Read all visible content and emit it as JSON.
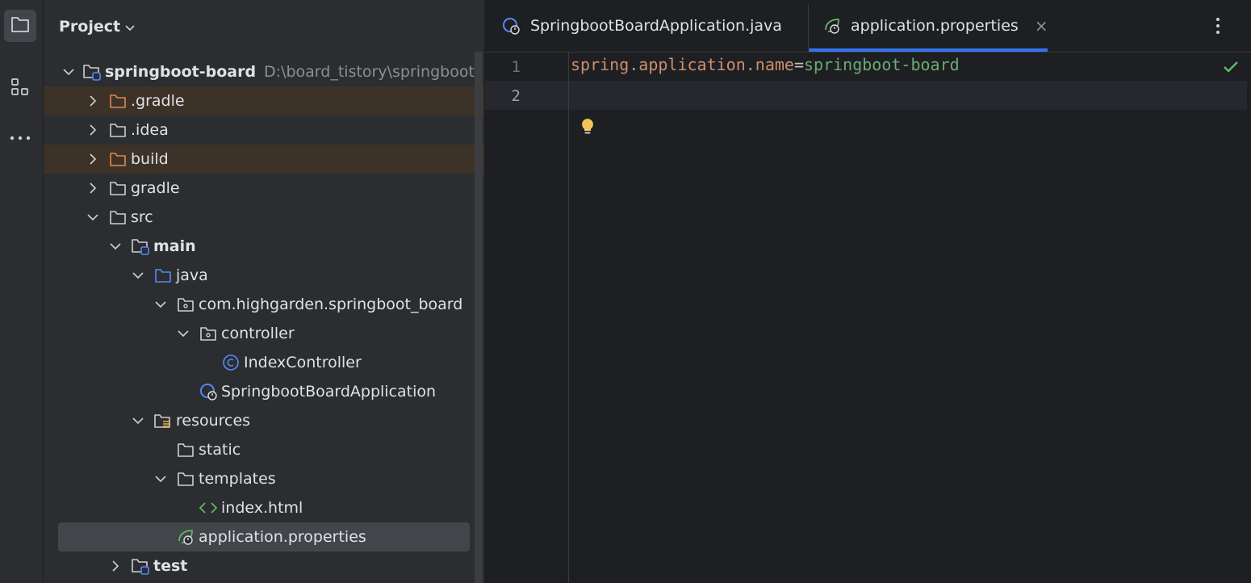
{
  "activity": {
    "items": [
      {
        "name": "project-tool",
        "icon": "folder-icon"
      },
      {
        "name": "structure-tool",
        "icon": "structure-icon"
      },
      {
        "name": "more-tools",
        "icon": "more-horizontal-icon"
      }
    ]
  },
  "project": {
    "title": "Project",
    "tree": [
      {
        "label": "springboot-board",
        "hint": "D:\\board_tistory\\springboot-bo",
        "depth": 0,
        "expanded": true,
        "icon": "module-folder-icon"
      },
      {
        "label": ".gradle",
        "depth": 1,
        "expanded": false,
        "icon": "folder-excluded-icon"
      },
      {
        "label": ".idea",
        "depth": 1,
        "expanded": false,
        "icon": "folder-icon"
      },
      {
        "label": "build",
        "depth": 1,
        "expanded": false,
        "icon": "folder-excluded-icon"
      },
      {
        "label": "gradle",
        "depth": 1,
        "expanded": false,
        "icon": "folder-icon"
      },
      {
        "label": "src",
        "depth": 1,
        "expanded": true,
        "icon": "folder-icon"
      },
      {
        "label": "main",
        "depth": 2,
        "expanded": true,
        "icon": "module-folder-icon"
      },
      {
        "label": "java",
        "depth": 3,
        "expanded": true,
        "icon": "source-folder-icon"
      },
      {
        "label": "com.highgarden.springboot_board",
        "depth": 4,
        "expanded": true,
        "icon": "package-icon"
      },
      {
        "label": "controller",
        "depth": 5,
        "expanded": true,
        "icon": "package-icon"
      },
      {
        "label": "IndexController",
        "depth": 6,
        "icon": "class-icon"
      },
      {
        "label": "SpringbootBoardApplication",
        "depth": 5,
        "icon": "spring-boot-class-icon"
      },
      {
        "label": "resources",
        "depth": 3,
        "expanded": true,
        "icon": "resources-folder-icon"
      },
      {
        "label": "static",
        "depth": 4,
        "icon": "folder-icon"
      },
      {
        "label": "templates",
        "depth": 4,
        "expanded": true,
        "icon": "folder-icon"
      },
      {
        "label": "index.html",
        "depth": 5,
        "icon": "html-file-icon"
      },
      {
        "label": "application.properties",
        "depth": 4,
        "icon": "spring-properties-icon"
      },
      {
        "label": "test",
        "depth": 2,
        "expanded": false,
        "icon": "module-folder-icon"
      }
    ]
  },
  "editor": {
    "tabs": [
      {
        "label": "SpringbootBoardApplication.java",
        "icon": "spring-boot-class-icon",
        "active": false
      },
      {
        "label": "application.properties",
        "icon": "spring-properties-icon",
        "active": true,
        "close": "×"
      }
    ],
    "line_numbers": [
      "1",
      "2"
    ],
    "code": {
      "key": "spring.application.name",
      "eq": "=",
      "value": "springboot-board"
    }
  },
  "colors": {
    "accent": "#3574f0",
    "excluded_row": "#3d3228",
    "selected_row": "#43454a",
    "prop_key": "#cf8e6d",
    "prop_value": "#6aab73",
    "ok_check": "#5fb865"
  }
}
